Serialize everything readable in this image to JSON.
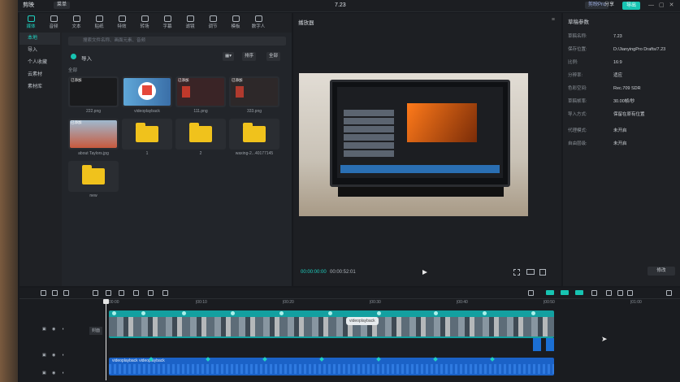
{
  "app": {
    "logo_text": "剪映",
    "menu_label": "菜单",
    "project_title": "7.23",
    "pro_label": "剪映Pro",
    "share_label": "分享",
    "export_label": "导出"
  },
  "toolbar": [
    {
      "label": "媒体"
    },
    {
      "label": "音频"
    },
    {
      "label": "文本"
    },
    {
      "label": "贴纸"
    },
    {
      "label": "特效"
    },
    {
      "label": "转场"
    },
    {
      "label": "字幕"
    },
    {
      "label": "滤镜"
    },
    {
      "label": "调节"
    },
    {
      "label": "模板"
    },
    {
      "label": "数字人"
    }
  ],
  "sidebar": [
    {
      "label": "本地"
    },
    {
      "label": "导入"
    },
    {
      "label": "个人收藏"
    },
    {
      "label": "云素材"
    },
    {
      "label": "素材库"
    }
  ],
  "media": {
    "search_placeholder": "搜索文件名称、画面元素、音频",
    "import_label": "导入",
    "sort_label": "排序",
    "filter_label": "全部",
    "section_label": "全部",
    "items": [
      {
        "name": "222.png",
        "tag": "已添加",
        "kind": "dark"
      },
      {
        "name": "videoplayback",
        "tag": "",
        "kind": "red"
      },
      {
        "name": "111.png",
        "tag": "已添加",
        "kind": "slide"
      },
      {
        "name": "333.png",
        "tag": "已添加",
        "kind": "slide"
      },
      {
        "name": "about Taylors.jpg",
        "tag": "已添加",
        "kind": "photo"
      },
      {
        "name": "1",
        "tag": "",
        "kind": "folder"
      },
      {
        "name": "2",
        "tag": "",
        "kind": "folder"
      },
      {
        "name": "waxing-2...40177145",
        "tag": "",
        "kind": "folder"
      },
      {
        "name": "new",
        "tag": "",
        "kind": "folder"
      }
    ]
  },
  "player": {
    "title": "播放器",
    "current_time": "00:00:00:00",
    "total_time": "00:00:52:01"
  },
  "props": {
    "title": "草稿参数",
    "rows": [
      {
        "k": "草稿名称:",
        "v": "7.23"
      },
      {
        "k": "保存位置:",
        "v": "D:/JianyingPro Drafts/7.23"
      },
      {
        "k": "比例:",
        "v": "16:9"
      },
      {
        "k": "分辨率:",
        "v": "适应"
      },
      {
        "k": "色彩空间:",
        "v": "Rec.709 SDR"
      },
      {
        "k": "草稿帧率:",
        "v": "30.00帧/秒"
      },
      {
        "k": "导入方式:",
        "v": "保留在原有位置"
      },
      {
        "k": "代理模式:",
        "v": "未开启"
      },
      {
        "k": "自由层级:",
        "v": "未开启"
      }
    ],
    "modify_label": "修改"
  },
  "timeline": {
    "ruler": [
      "00:00",
      "|00:10",
      "|00:20",
      "|00:30",
      "|00:40",
      "|00:50",
      "|01:00"
    ],
    "cover_label": "封面",
    "clip_label": "videoplayback",
    "audio_label": "videoplayback  videoplayback"
  }
}
